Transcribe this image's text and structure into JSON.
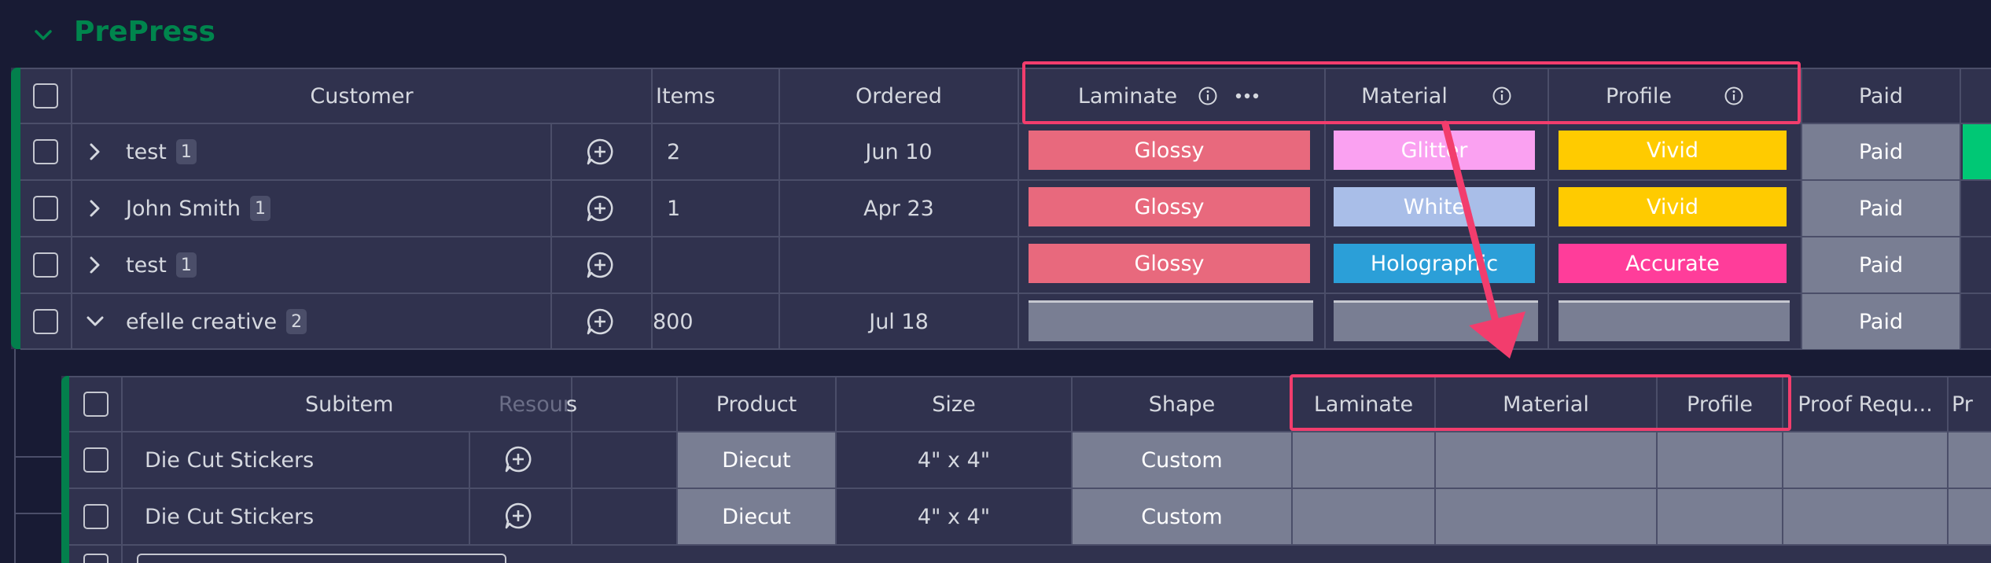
{
  "group": {
    "title": "PrePress"
  },
  "main_headers": {
    "customer": "Customer",
    "items": "Items",
    "ordered": "Ordered",
    "laminate": "Laminate",
    "material": "Material",
    "profile": "Profile",
    "paid": "Paid"
  },
  "rows": [
    {
      "name": "test",
      "count": "1",
      "items": "2",
      "ordered": "Jun 10",
      "laminate": "Glossy",
      "material": "Glitter",
      "profile": "Vivid",
      "paid": "Paid"
    },
    {
      "name": "John Smith",
      "count": "1",
      "items": "1",
      "ordered": "Apr 23",
      "laminate": "Glossy",
      "material": "White",
      "profile": "Vivid",
      "paid": "Paid"
    },
    {
      "name": "test",
      "count": "1",
      "items": "",
      "ordered": "",
      "laminate": "Glossy",
      "material": "Holographic",
      "profile": "Accurate",
      "paid": "Paid"
    },
    {
      "name": "efelle creative",
      "count": "2",
      "items": "800",
      "ordered": "Jul 18",
      "laminate": "",
      "material": "",
      "profile": "",
      "paid": "Paid"
    }
  ],
  "sub_headers": {
    "subitem": "Subitem",
    "ghost": "Resour",
    "ghost_suffix": "s",
    "product": "Product",
    "size": "Size",
    "shape": "Shape",
    "laminate": "Laminate",
    "material": "Material",
    "profile": "Profile",
    "proof": "Proof Requ...",
    "cut": "Pr"
  },
  "subrows": [
    {
      "name": "Die Cut Stickers",
      "product": "Diecut",
      "size": "4\" x 4\"",
      "shape": "Custom"
    },
    {
      "name": "Die Cut Stickers",
      "product": "Diecut",
      "size": "4\" x 4\"",
      "shape": "Custom"
    }
  ],
  "colors": {
    "glossy": "#e8697d",
    "glitter": "#faa1f1",
    "white": "#a9bee8",
    "holographic": "#2b9fd8",
    "vivid": "#ffcb00",
    "accurate": "#ff3d9a",
    "paid": "#797e93",
    "accent_green": "#037f4c",
    "highlight": "#f23d6d"
  },
  "icons": {
    "group_toggle": "chevron-down-icon",
    "add_update": "add-update-icon",
    "info": "info-icon",
    "more": "more-icon"
  }
}
